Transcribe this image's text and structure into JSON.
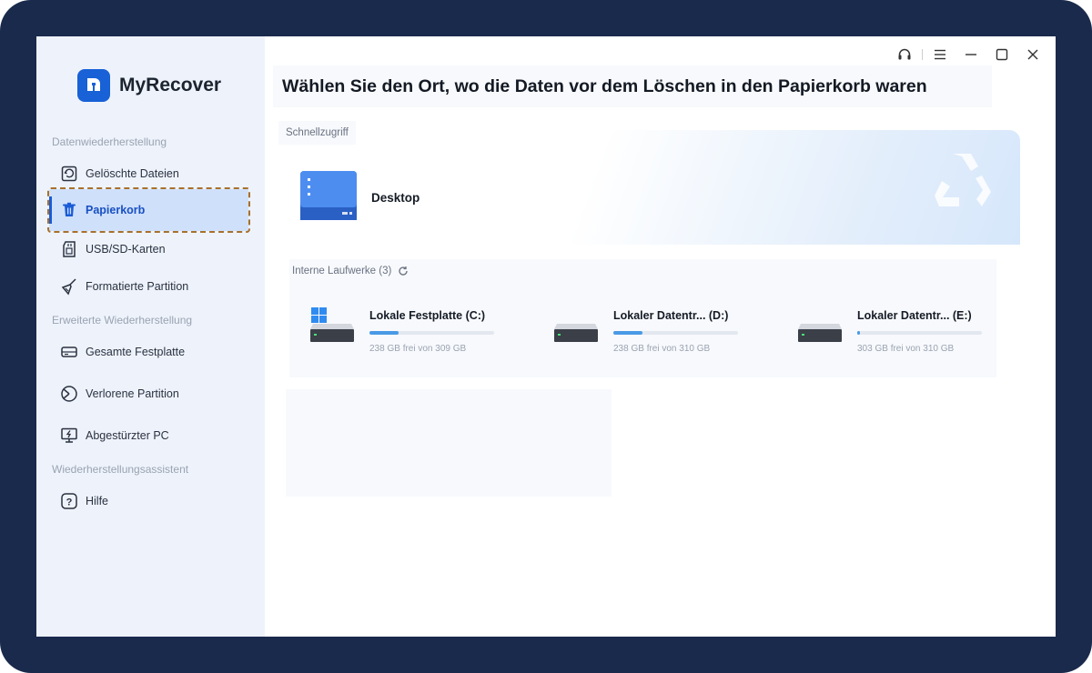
{
  "app": {
    "name": "MyRecover"
  },
  "sidebar": {
    "section_data_recovery": "Datenwiederherstellung",
    "section_advanced": "Erweiterte Wiederherstellung",
    "section_assistant": "Wiederherstellungsassistent",
    "items": [
      {
        "label": "Gelöschte Dateien",
        "icon": "restore-icon"
      },
      {
        "label": "Papierkorb",
        "icon": "trash-icon",
        "active": true
      },
      {
        "label": "USB/SD-Karten",
        "icon": "sd-card-icon"
      },
      {
        "label": "Formatierte Partition",
        "icon": "broom-icon"
      },
      {
        "label": "Gesamte Festplatte",
        "icon": "hard-disk-icon"
      },
      {
        "label": "Verlorene Partition",
        "icon": "pie-icon"
      },
      {
        "label": "Abgestürzter PC",
        "icon": "crashed-pc-icon"
      },
      {
        "label": "Hilfe",
        "icon": "help-icon"
      }
    ]
  },
  "titlebar": {
    "icons": [
      "headset-icon",
      "menu-icon",
      "minimize-icon",
      "maximize-icon",
      "close-icon"
    ]
  },
  "main": {
    "title": "Wählen Sie den Ort, wo die Daten vor dem Löschen in den Papierkorb waren",
    "quick_access": {
      "label": "Schnellzugriff",
      "items": [
        {
          "label": "Desktop",
          "icon": "desktop-folder-icon"
        }
      ]
    },
    "drives": {
      "label": "Interne Laufwerke (3)",
      "items": [
        {
          "name": "Lokale Festplatte (C:)",
          "info": "238 GB frei von 309 GB",
          "used_fraction": 0.23,
          "system": true
        },
        {
          "name": "Lokaler Datentr... (D:)",
          "info": "238 GB frei von 310 GB",
          "used_fraction": 0.23,
          "system": false
        },
        {
          "name": "Lokaler Datentr... (E:)",
          "info": "303 GB frei von 310 GB",
          "used_fraction": 0.02,
          "system": false
        }
      ]
    }
  },
  "colors": {
    "accent": "#1a5cd6",
    "frame": "#1a2a4c",
    "sidebar": "#eef3fb",
    "active_bg": "#cfe0fb",
    "highlight_outline": "#a8702c",
    "progress": "#4a9ae6"
  }
}
